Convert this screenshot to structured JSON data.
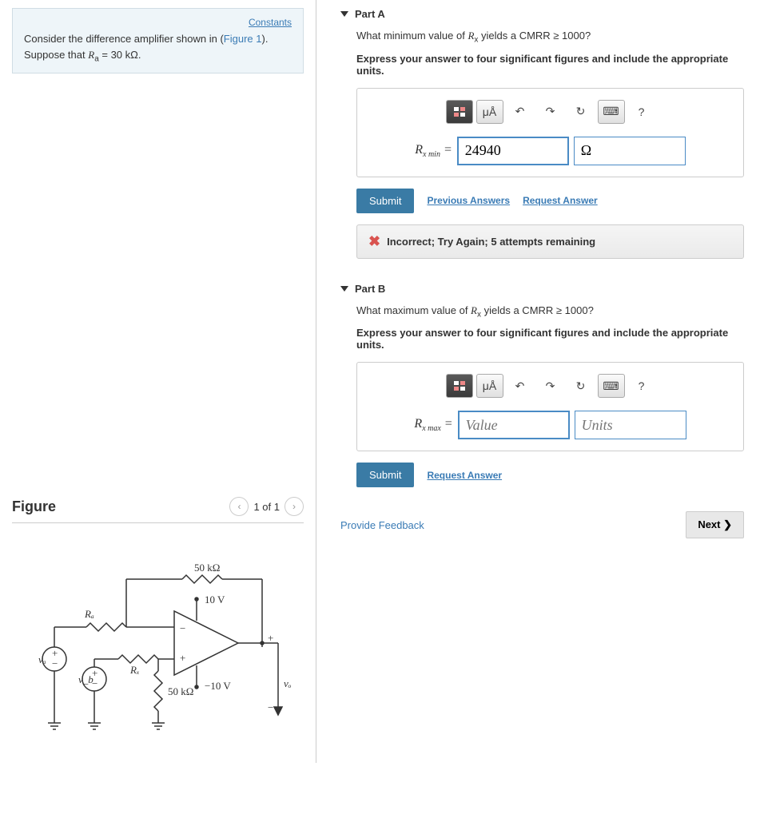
{
  "constants_link": "Constants",
  "problem": {
    "text_1": "Consider the difference amplifier shown in (",
    "figure_link": "Figure 1",
    "text_2": ").",
    "text_3": "Suppose that ",
    "var": "R",
    "sub": "a",
    "eq": " = 30 kΩ."
  },
  "figure": {
    "title": "Figure",
    "page": "1 of 1",
    "r_top": "50 kΩ",
    "r_a": "Rₐ",
    "r_x": "Rₓ",
    "r_bottom": "50 kΩ",
    "v_plus": "10 V",
    "v_minus": "−10 V",
    "va": "vₐ",
    "vb": "v_b",
    "vo": "vₒ"
  },
  "partA": {
    "title": "Part A",
    "question_1": "What minimum value of ",
    "var": "R",
    "sub": "x",
    "question_2": " yields a CMRR ≥ 1000?",
    "instruction": "Express your answer to four significant figures and include the appropriate units.",
    "label_var": "R",
    "label_sub": "x min",
    "label_eq": " = ",
    "value": "24940",
    "units": "Ω",
    "submit": "Submit",
    "prev_answers": "Previous Answers",
    "request_answer": "Request Answer",
    "feedback": "Incorrect; Try Again; 5 attempts remaining"
  },
  "partB": {
    "title": "Part B",
    "question_1": "What maximum value of ",
    "var": "R",
    "sub": "x",
    "question_2": " yields a CMRR ≥ 1000?",
    "instruction": "Express your answer to four significant figures and include the appropriate units.",
    "label_var": "R",
    "label_sub": "x max",
    "label_eq": " = ",
    "value_placeholder": "Value",
    "units_placeholder": "Units",
    "submit": "Submit",
    "request_answer": "Request Answer"
  },
  "toolbar": {
    "mu_a": "μÅ",
    "undo": "↶",
    "redo": "↷",
    "reset": "↻",
    "help": "?"
  },
  "footer": {
    "provide_feedback": "Provide Feedback",
    "next": "Next ❯"
  }
}
